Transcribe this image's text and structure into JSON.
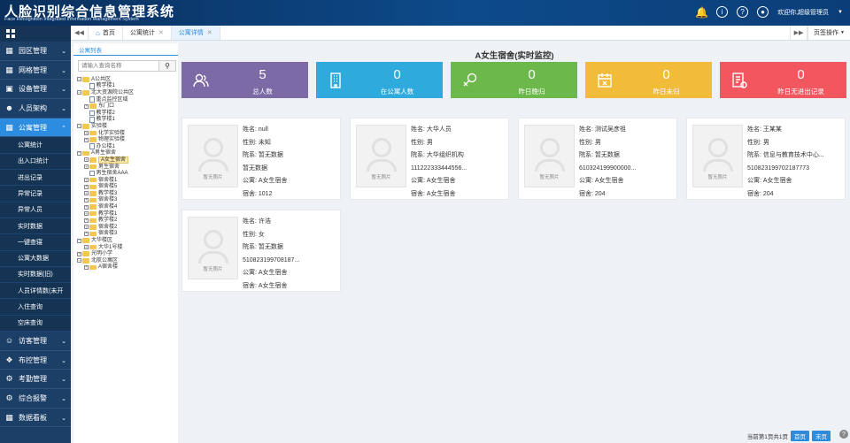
{
  "app": {
    "title": "人脸识别综合信息管理系统",
    "subtitle": "Face Recognition Integrated Information Management System",
    "user_greeting": "欢迎你,超级管理员"
  },
  "sidebar": {
    "menus": [
      {
        "label": "园区管理",
        "icon": "building-icon"
      },
      {
        "label": "网格管理",
        "icon": "grid-icon"
      },
      {
        "label": "设备管理",
        "icon": "device-icon"
      },
      {
        "label": "人员架构",
        "icon": "people-icon"
      },
      {
        "label": "公寓管理",
        "icon": "apartment-icon",
        "active": true
      }
    ],
    "sub_items": [
      "公寓统计",
      "出入口统计",
      "进出记录",
      "异常记录",
      "异常人员",
      "实时数据",
      "一键查寝",
      "公寓大数据",
      "实时数据(旧)",
      "人员详情数(未开",
      "入住查询",
      "空床查询"
    ],
    "menus_bottom": [
      {
        "label": "访客管理",
        "icon": "visitor-icon"
      },
      {
        "label": "布控管理",
        "icon": "control-icon"
      },
      {
        "label": "考勤管理",
        "icon": "attendance-icon"
      },
      {
        "label": "综合报警",
        "icon": "alarm-icon"
      },
      {
        "label": "数据看板",
        "icon": "dashboard-icon"
      }
    ]
  },
  "tabs": {
    "home": "首页",
    "items": [
      "公寓统计",
      "公寓详情"
    ],
    "ops": "页签操作"
  },
  "tree": {
    "title": "公寓列表",
    "search_placeholder": "请输入查询名称",
    "nodes": [
      {
        "label": "A公共区",
        "type": "folder",
        "level": 0,
        "toggle": "−"
      },
      {
        "label": "教学楼1",
        "type": "page",
        "level": 1
      },
      {
        "label": "北大资源院公共区",
        "type": "folder",
        "level": 0,
        "toggle": "−"
      },
      {
        "label": "重点监控区域",
        "type": "page",
        "level": 1
      },
      {
        "label": "东门口",
        "type": "folder",
        "level": 1,
        "toggle": "+"
      },
      {
        "label": "教学楼2",
        "type": "page",
        "level": 1
      },
      {
        "label": "教学楼1",
        "type": "page",
        "level": 1
      },
      {
        "label": "实验楼",
        "type": "folder",
        "level": 0,
        "toggle": "−"
      },
      {
        "label": "化学实验楼",
        "type": "folder",
        "level": 1,
        "toggle": "+"
      },
      {
        "label": "物理实验楼",
        "type": "folder",
        "level": 1,
        "toggle": "+"
      },
      {
        "label": "办公楼1",
        "type": "page",
        "level": 1
      },
      {
        "label": "A男生宿舍",
        "type": "folder",
        "level": 0,
        "toggle": "−"
      },
      {
        "label": "A女生宿舍",
        "type": "folder",
        "level": 1,
        "toggle": "+",
        "selected": true
      },
      {
        "label": "男生宿舍",
        "type": "folder",
        "level": 1,
        "toggle": "+"
      },
      {
        "label": "男生宿舍AAA",
        "type": "page",
        "level": 1
      },
      {
        "label": "宿舍楼1",
        "type": "folder",
        "level": 1,
        "toggle": "+"
      },
      {
        "label": "宿舍楼5",
        "type": "folder",
        "level": 1,
        "toggle": "+"
      },
      {
        "label": "教学楼3",
        "type": "folder",
        "level": 1,
        "toggle": "+"
      },
      {
        "label": "宿舍楼3",
        "type": "folder",
        "level": 1,
        "toggle": "+"
      },
      {
        "label": "宿舍楼4",
        "type": "folder",
        "level": 1,
        "toggle": "+"
      },
      {
        "label": "教学楼1",
        "type": "folder",
        "level": 1,
        "toggle": "+"
      },
      {
        "label": "教学楼2",
        "type": "folder",
        "level": 1,
        "toggle": "+"
      },
      {
        "label": "宿舍楼2",
        "type": "folder",
        "level": 1,
        "toggle": "+"
      },
      {
        "label": "宿舍楼3",
        "type": "folder",
        "level": 1,
        "toggle": "+"
      },
      {
        "label": "大华楼区",
        "type": "folder",
        "level": 0,
        "toggle": "−"
      },
      {
        "label": "大华1号楼",
        "type": "folder",
        "level": 1,
        "toggle": "+"
      },
      {
        "label": "光明小学",
        "type": "folder",
        "level": 0,
        "toggle": "+"
      },
      {
        "label": "北航公寓区",
        "type": "folder",
        "level": 0,
        "toggle": "−"
      },
      {
        "label": "A宿舍楼",
        "type": "folder",
        "level": 1,
        "toggle": "+"
      }
    ]
  },
  "main": {
    "title": "A女生宿舍(实时监控)",
    "stats": [
      {
        "value": "5",
        "label": "总人数",
        "color": "#7b6aa6",
        "icon": "people-icon"
      },
      {
        "value": "0",
        "label": "在公寓人数",
        "color": "#2eaadc",
        "icon": "building-icon"
      },
      {
        "value": "0",
        "label": "昨日晚归",
        "color": "#6cb84a",
        "icon": "night-return-icon"
      },
      {
        "value": "0",
        "label": "昨日未归",
        "color": "#f2bc3b",
        "icon": "calendar-x-icon"
      },
      {
        "value": "0",
        "label": "昨日无进出记录",
        "color": "#f2575f",
        "icon": "record-icon"
      }
    ],
    "photo_placeholder": "暂无照片",
    "people": [
      {
        "lines": [
          "姓名: null",
          "性别: 未知",
          "院系: 暂无数据",
          "暂无数据",
          "公寓: A女生宿舍",
          "宿舍: 1012"
        ]
      },
      {
        "lines": [
          "姓名: 大华人员",
          "性别: 男",
          "院系: 大华组织机构",
          "111222333444556...",
          "公寓: A女生宿舍",
          "宿舍: A女生宿舍"
        ]
      },
      {
        "lines": [
          "姓名: 测试吴彦祖",
          "性别: 男",
          "院系: 暂无数据",
          "610324199900000...",
          "公寓: A女生宿舍",
          "宿舍: 204"
        ]
      },
      {
        "lines": [
          "姓名: 王某某",
          "性别: 男",
          "院系: 信息与教育技术中心...",
          "510823199702187773",
          "公寓: A女生宿舍",
          "宿舍: 204"
        ]
      },
      {
        "lines": [
          "姓名: 许浩",
          "性别: 女",
          "院系: 暂无数据",
          "510823199708187...",
          "公寓: A女生宿舍",
          "宿舍: A女生宿舍"
        ]
      }
    ]
  },
  "pager": {
    "text": "当前第1页共1页",
    "first": "首页",
    "last": "末页"
  }
}
